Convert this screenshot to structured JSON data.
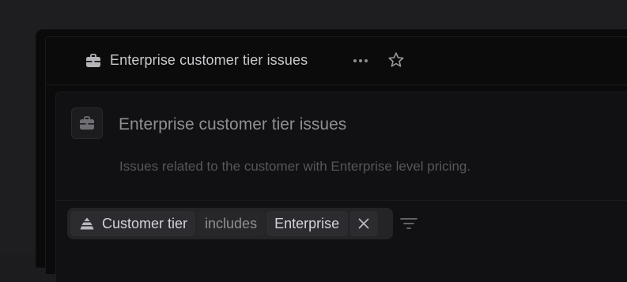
{
  "header": {
    "title": "Enterprise customer tier issues",
    "icons": {
      "view_icon": "briefcase-icon",
      "more": "more-horizontal-icon",
      "favorite": "star-icon"
    }
  },
  "view": {
    "icon": "briefcase-icon",
    "title": "Enterprise customer tier issues",
    "description": "Issues related to the customer with Enterprise level pricing."
  },
  "filter": {
    "field_icon": "layers-icon",
    "field": "Customer tier",
    "operator": "includes",
    "value": "Enterprise",
    "remove_icon": "close-icon",
    "options_icon": "filter-lines-icon"
  },
  "colors": {
    "background": "#1e1e20",
    "window": "#0b0b0c",
    "card": "#111113",
    "chip": "#2c2c30",
    "text_primary": "#d4d4d8",
    "text_muted": "#8e8e93",
    "text_faint": "#56565b"
  }
}
